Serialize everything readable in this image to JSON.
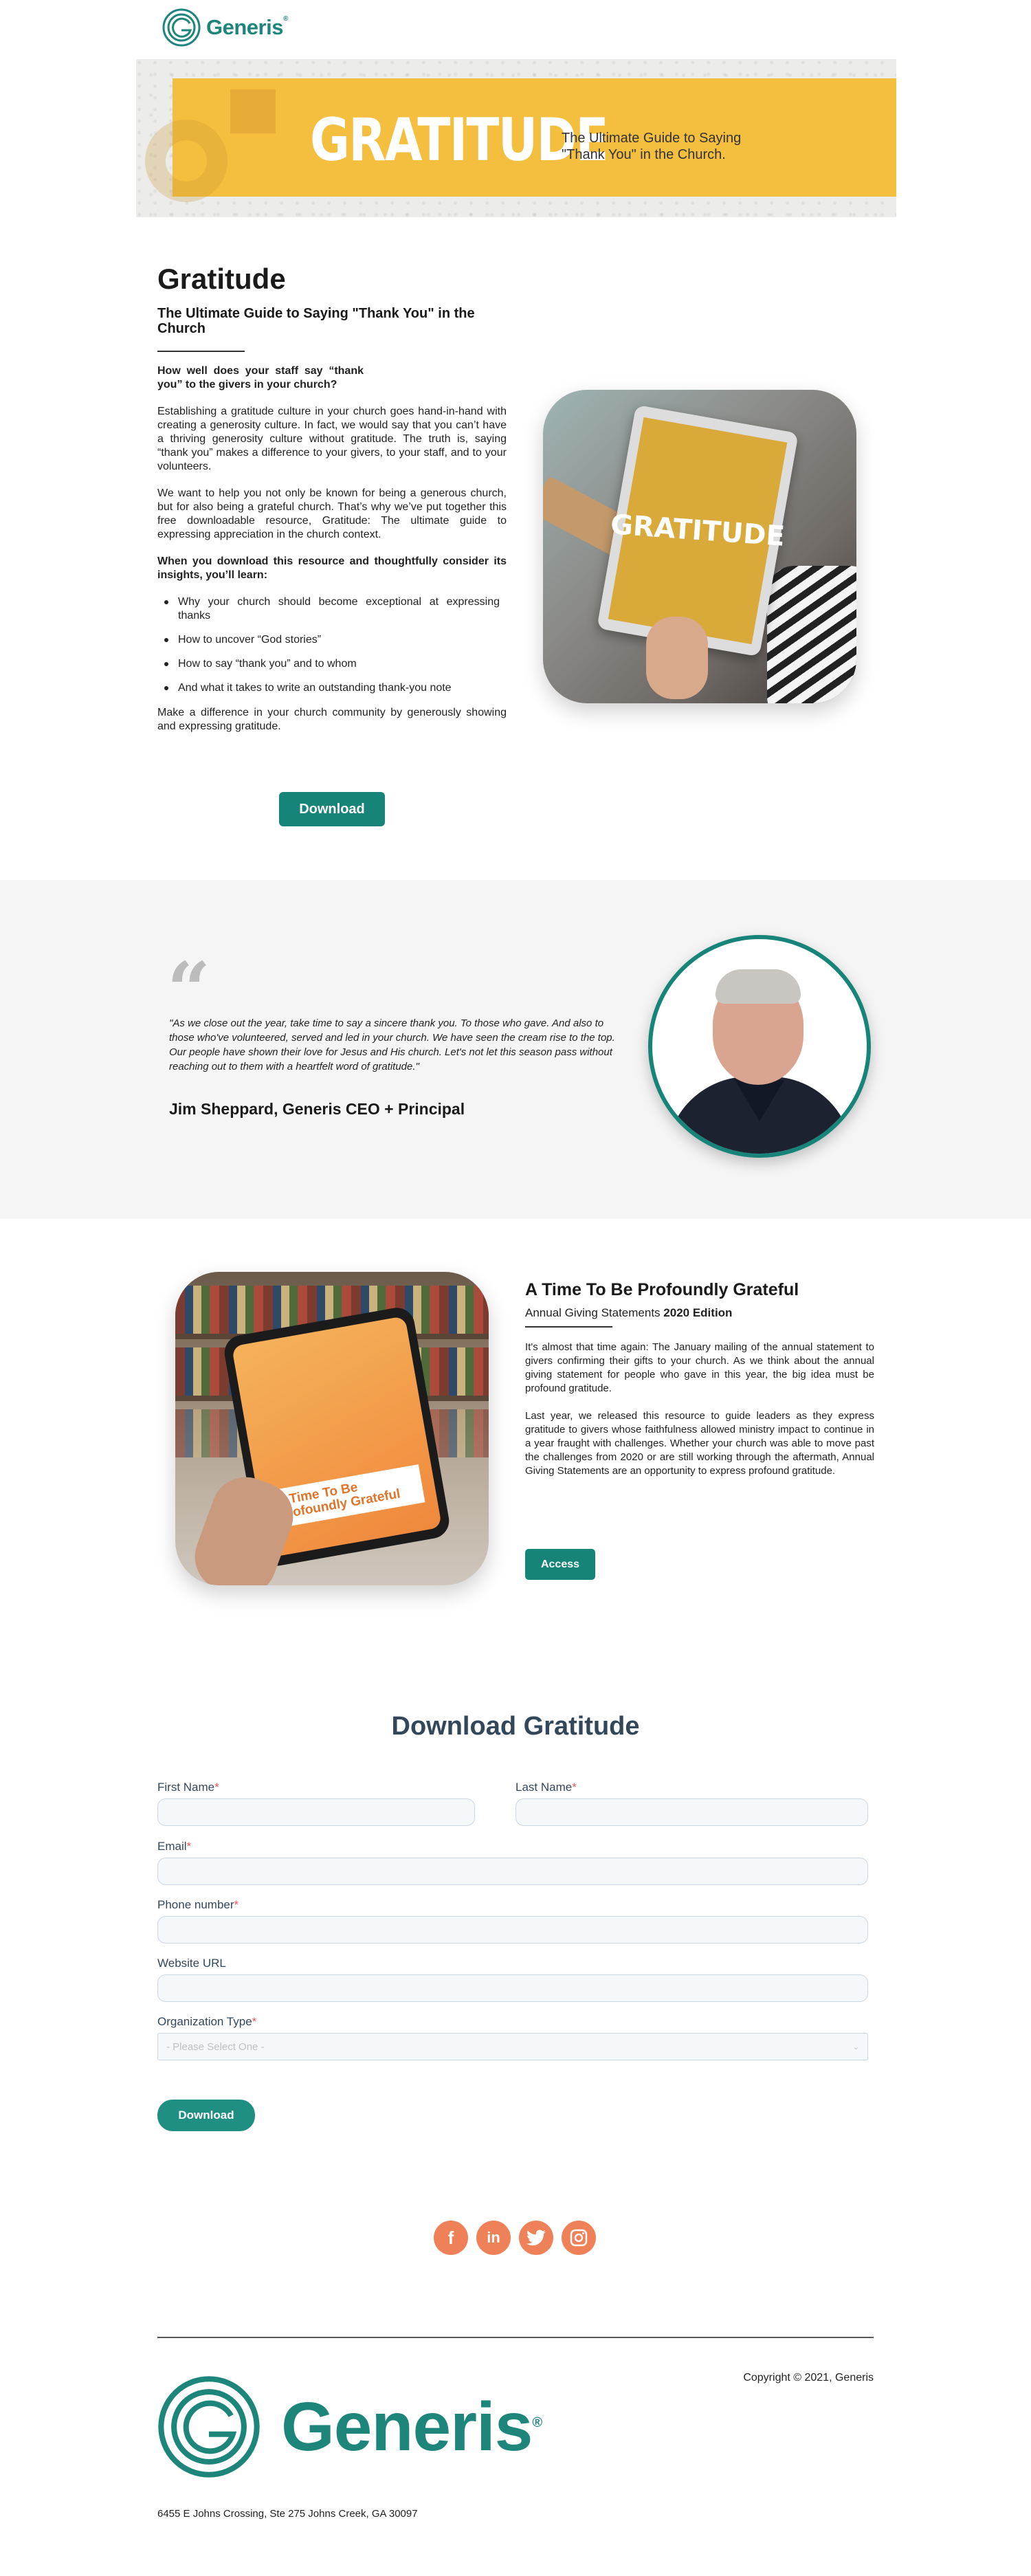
{
  "header": {
    "brand": "Generis",
    "reg": "®"
  },
  "banner": {
    "title": "GRATITUDE",
    "subtitle_line1": "The Ultimate Guide to Saying",
    "subtitle_line2": "\"Thank You\" in the Church."
  },
  "intro": {
    "title": "Gratitude",
    "subtitle": "The Ultimate Guide to Saying \"Thank You\" in the Church",
    "question": "How well does your staff say “thank you” to the givers in your church?",
    "p1": "Establishing a gratitude culture in your church goes hand-in-hand with creating a generosity culture. In fact, we would say that you can’t have a thriving generosity culture without gratitude. The truth is, saying “thank you” makes a difference to your givers, to your staff, and to your volunteers.",
    "p2": "We want to help you not only be known for being a generous church, but for also being a grateful church. That’s why we’ve put together this free downloadable resource, Gratitude: The ultimate guide to expressing appreciation in the church context.",
    "learn_heading": "When you download this resource and thoughtfully consider its insights, you’ll learn:",
    "bullets": [
      "Why your church should become exceptional at expressing thanks",
      "How to uncover “God stories”",
      "How to say “thank you” and to whom",
      "And what it takes to write an outstanding thank-you note"
    ],
    "closing": "Make a difference in your church community by generously showing and expressing gratitude.",
    "download_button": "Download",
    "tablet_screen_text": "GRATITUDE"
  },
  "testimonial": {
    "quote_mark": "“",
    "quote": "\"As we close out the year, take time to say a sincere thank you. To those who gave. And also to those who've volunteered, served and led in your church. We have seen the cream rise to the top. Our people have shown their love for Jesus and His church. Let's not let this season pass without reaching out to them with a heartfelt word of gratitude.\"",
    "author": "Jim Sheppard, Generis CEO + Principal"
  },
  "agsc": {
    "title": "A Time To Be Profoundly Grateful",
    "subtitle_plain": "Annual Giving Statements",
    "subtitle_bold": "2020 Edition",
    "p1": "It's almost that time again: The January mailing of the annual statement to givers confirming their gifts to your church. As we think about the annual giving statement for people who gave in this year, the big idea must be profound gratitude.",
    "p2": "Last year, we released this resource to guide leaders as they express gratitude to givers whose faithfulness allowed ministry impact to continue in a year fraught with challenges. Whether your church was able to move past the challenges from 2020 or are still working through the aftermath, Annual Giving Statements are an opportunity to express profound gratitude.",
    "access_button": "Access",
    "tablet_screen_text": "A Time To Be Profoundly Grateful"
  },
  "form": {
    "title": "Download Gratitude",
    "required_mark": "*",
    "first_name_label": "First Name",
    "last_name_label": "Last Name",
    "email_label": "Email",
    "phone_label": "Phone number",
    "website_label": "Website URL",
    "org_type_label": "Organization Type",
    "org_type_selected": "- Please Select One -",
    "submit": "Download"
  },
  "social": {
    "icons": [
      "facebook-icon",
      "linkedin-icon",
      "twitter-icon",
      "instagram-icon"
    ],
    "color": "#ef8158"
  },
  "footer": {
    "copyright": "Copyright © 2021, Generis",
    "brand": "Generis",
    "reg": "®",
    "address": "6455 E Johns Crossing, Ste 275 Johns Creek, GA 30097"
  },
  "colors": {
    "accent": "#168478",
    "banner": "#f4be3f",
    "form_text": "#33475b",
    "required": "#f2545b"
  }
}
